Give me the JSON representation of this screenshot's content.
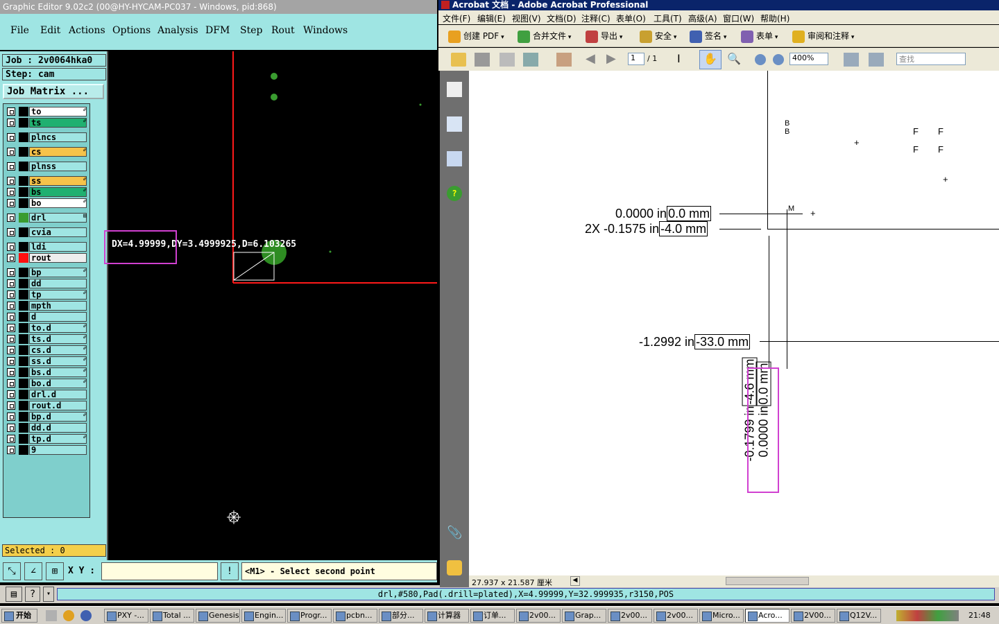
{
  "genesis": {
    "title": "Graphic Editor 9.02c2 (00@HY-HYCAM-PC037 - Windows, pid:868)",
    "menus": [
      "File",
      "Edit",
      "Actions",
      "Options",
      "Analysis",
      "DFM",
      "Step",
      "Rout",
      "Windows"
    ],
    "job_label": "Job : 2v0064hka0",
    "step_label": "Step: cam",
    "job_matrix_button": "Job Matrix ...",
    "layers": [
      {
        "name": "to",
        "color": "#000000",
        "box": "#ffffff",
        "flag": "✐"
      },
      {
        "name": "ts",
        "color": "#000000",
        "box": "#20b070",
        "flag": "✐"
      },
      {
        "name": "plncs",
        "color": "#000000",
        "box": "#9fe5e3",
        "flag": ""
      },
      {
        "name": "cs",
        "color": "#000000",
        "box": "#f6c34a",
        "flag": "✐"
      },
      {
        "name": "plnss",
        "color": "#000000",
        "box": "#9fe5e3",
        "flag": ""
      },
      {
        "name": "ss",
        "color": "#000000",
        "box": "#f6c34a",
        "flag": "✐"
      },
      {
        "name": "bs",
        "color": "#000000",
        "box": "#20b070",
        "flag": "✐"
      },
      {
        "name": "bo",
        "color": "#000000",
        "box": "#ffffff",
        "flag": "✐"
      },
      {
        "name": "drl",
        "color": "#3a9c30",
        "box": "#9fe5e3",
        "flag": "⊞"
      },
      {
        "name": "cvia",
        "color": "#000000",
        "box": "#9fe5e3",
        "flag": ""
      },
      {
        "name": "ldi",
        "color": "#000000",
        "box": "#9fe5e3",
        "flag": ""
      },
      {
        "name": "rout",
        "color": "#ff1010",
        "box": "#eeeeee",
        "flag": ""
      },
      {
        "name": "bp",
        "color": "#000000",
        "box": "#9fe5e3",
        "flag": "✐"
      },
      {
        "name": "dd",
        "color": "#000000",
        "box": "#9fe5e3",
        "flag": ""
      },
      {
        "name": "tp",
        "color": "#000000",
        "box": "#9fe5e3",
        "flag": "✐"
      },
      {
        "name": "mpth",
        "color": "#000000",
        "box": "#9fe5e3",
        "flag": ""
      },
      {
        "name": "d",
        "color": "#000000",
        "box": "#9fe5e3",
        "flag": ""
      },
      {
        "name": "to.d",
        "color": "#000000",
        "box": "#9fe5e3",
        "flag": "✐"
      },
      {
        "name": "ts.d",
        "color": "#000000",
        "box": "#9fe5e3",
        "flag": "✐"
      },
      {
        "name": "cs.d",
        "color": "#000000",
        "box": "#9fe5e3",
        "flag": "✐"
      },
      {
        "name": "ss.d",
        "color": "#000000",
        "box": "#9fe5e3",
        "flag": "✐"
      },
      {
        "name": "bs.d",
        "color": "#000000",
        "box": "#9fe5e3",
        "flag": "✐"
      },
      {
        "name": "bo.d",
        "color": "#000000",
        "box": "#9fe5e3",
        "flag": "✐"
      },
      {
        "name": "drl.d",
        "color": "#000000",
        "box": "#9fe5e3",
        "flag": ""
      },
      {
        "name": "rout.d",
        "color": "#000000",
        "box": "#9fe5e3",
        "flag": ""
      },
      {
        "name": "bp.d",
        "color": "#000000",
        "box": "#9fe5e3",
        "flag": "✐"
      },
      {
        "name": "dd.d",
        "color": "#000000",
        "box": "#9fe5e3",
        "flag": ""
      },
      {
        "name": "tp.d",
        "color": "#000000",
        "box": "#9fe5e3",
        "flag": "✐"
      },
      {
        "name": "9",
        "color": "#000000",
        "box": "#9fe5e3",
        "flag": ""
      }
    ],
    "selected_label": "Selected : 0",
    "measure_text": "DX=4.99999,DY=3.4999925,D=6.103265",
    "xy_label": "X Y :",
    "xy_value": "",
    "status_message": "<M1> - Select second point",
    "info_text": "drl,#580,Pad(.drill=plated),X=4.99999,Y=32.999935,r3150,POS"
  },
  "acrobat": {
    "title": "Acrobat 文档 - Adobe Acrobat Professional",
    "menus": [
      "文件(F)",
      "编辑(E)",
      "视图(V)",
      "文档(D)",
      "注释(C)",
      "表单(O)",
      "工具(T)",
      "高级(A)",
      "窗口(W)",
      "帮助(H)"
    ],
    "toolbar1": [
      {
        "label": "创建 PDF",
        "icon": "create-pdf-icon",
        "color": "#e8a020"
      },
      {
        "label": "合并文件",
        "icon": "combine-icon",
        "color": "#40a040"
      },
      {
        "label": "导出",
        "icon": "export-icon",
        "color": "#c04040"
      },
      {
        "label": "安全",
        "icon": "lock-icon",
        "color": "#c8a030"
      },
      {
        "label": "签名",
        "icon": "pen-icon",
        "color": "#4060b0"
      },
      {
        "label": "表单",
        "icon": "form-icon",
        "color": "#8060b0"
      },
      {
        "label": "审阅和注释",
        "icon": "comment-icon",
        "color": "#e0b020"
      }
    ],
    "page_current": "1",
    "page_total": "/ 1",
    "zoom": "400%",
    "search_placeholder": "查找",
    "page_size": "27.937 x 21.587 厘米",
    "dims": {
      "d1_in": "0.0000 in",
      "d1_mm": "0.0 mm",
      "d2_in": "2X -0.1575 in",
      "d2_mm": "-4.0 mm",
      "d3_in": "-1.2992 in",
      "d3_mm": "-33.0 mm",
      "v1_in": "-0.1799 in",
      "v1_mm": "-4.6 mm",
      "v2_in": "0.0000 in",
      "v2_mm": "0.0 mm"
    },
    "marks": {
      "b": "B",
      "m": "M",
      "f": "F"
    }
  },
  "taskbar": {
    "start": "开始",
    "tasks": [
      "PXY -...",
      "Total ...",
      "Genesis",
      "Engin...",
      "Progr...",
      "pcbn...",
      "部分...",
      "计算器",
      "订单...",
      "2v00...",
      "Grap...",
      "2v00...",
      "2v00...",
      "Micro...",
      "Acro...",
      "2V00...",
      "Q12V..."
    ],
    "clock": "21:48"
  }
}
